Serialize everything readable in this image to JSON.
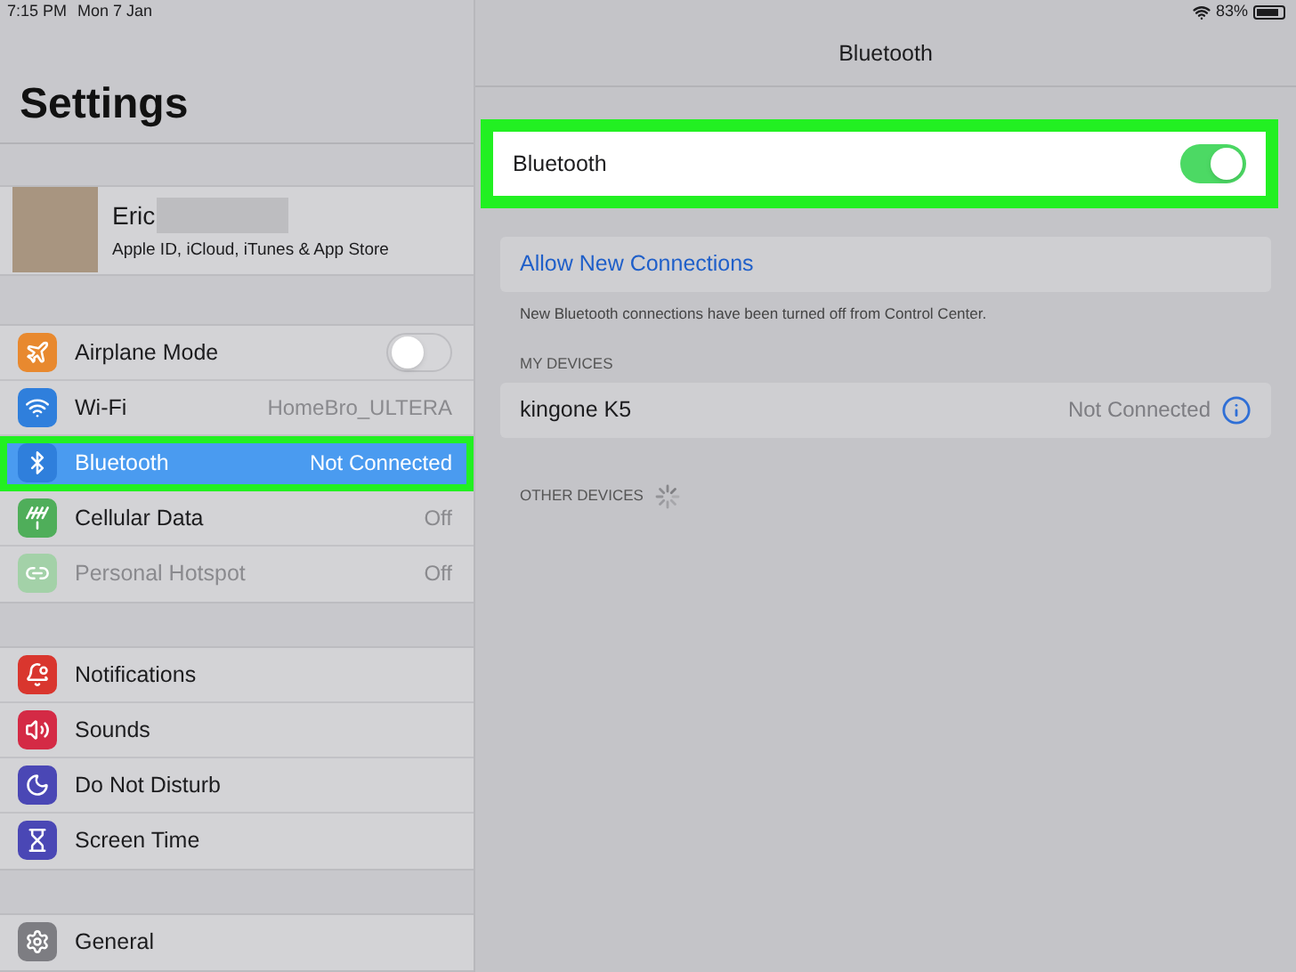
{
  "status_bar": {
    "time": "7:15 PM",
    "date": "Mon 7 Jan",
    "battery": "83%"
  },
  "sidebar": {
    "title": "Settings",
    "profile": {
      "name": "Eric",
      "subtitle": "Apple ID, iCloud, iTunes & App Store"
    },
    "groups": [
      [
        {
          "kind": "toggle",
          "label": "Airplane Mode",
          "on": false,
          "selected": false,
          "disabled": false,
          "highlighted": false,
          "color": "#e8892f"
        },
        {
          "kind": "value",
          "label": "Wi-Fi",
          "value": "HomeBro_ULTERA",
          "selected": false,
          "disabled": false,
          "highlighted": false,
          "color": "#2f7fdc"
        },
        {
          "kind": "value",
          "label": "Bluetooth",
          "value": "Not Connected",
          "selected": true,
          "disabled": false,
          "highlighted": true,
          "color": "#2f7fdc"
        },
        {
          "kind": "value",
          "label": "Cellular Data",
          "value": "Off",
          "selected": false,
          "disabled": false,
          "highlighted": false,
          "color": "#4fae5a"
        },
        {
          "kind": "value",
          "label": "Personal Hotspot",
          "value": "Off",
          "selected": false,
          "disabled": true,
          "highlighted": false,
          "color": "#a3d1a8"
        }
      ],
      [
        {
          "kind": "plain",
          "label": "Notifications",
          "selected": false,
          "disabled": false,
          "highlighted": false,
          "color": "#d9362e"
        },
        {
          "kind": "plain",
          "label": "Sounds",
          "selected": false,
          "disabled": false,
          "highlighted": false,
          "color": "#d42a45"
        },
        {
          "kind": "plain",
          "label": "Do Not Disturb",
          "selected": false,
          "disabled": false,
          "highlighted": false,
          "color": "#4a47b5"
        },
        {
          "kind": "plain",
          "label": "Screen Time",
          "selected": false,
          "disabled": false,
          "highlighted": false,
          "color": "#4a47b5"
        }
      ],
      [
        {
          "kind": "plain",
          "label": "General",
          "selected": false,
          "disabled": false,
          "highlighted": false,
          "color": "#7d7d82"
        }
      ]
    ]
  },
  "detail": {
    "title": "Bluetooth",
    "toggle": {
      "label": "Bluetooth",
      "on": true,
      "highlighted": true
    },
    "allow_link": "Allow New Connections",
    "footnote": "New Bluetooth connections have been turned off from Control Center.",
    "my_devices_header": "MY DEVICES",
    "devices": [
      {
        "name": "kingone K5",
        "status": "Not Connected"
      }
    ],
    "other_devices_header": "OTHER DEVICES",
    "searching": true
  }
}
